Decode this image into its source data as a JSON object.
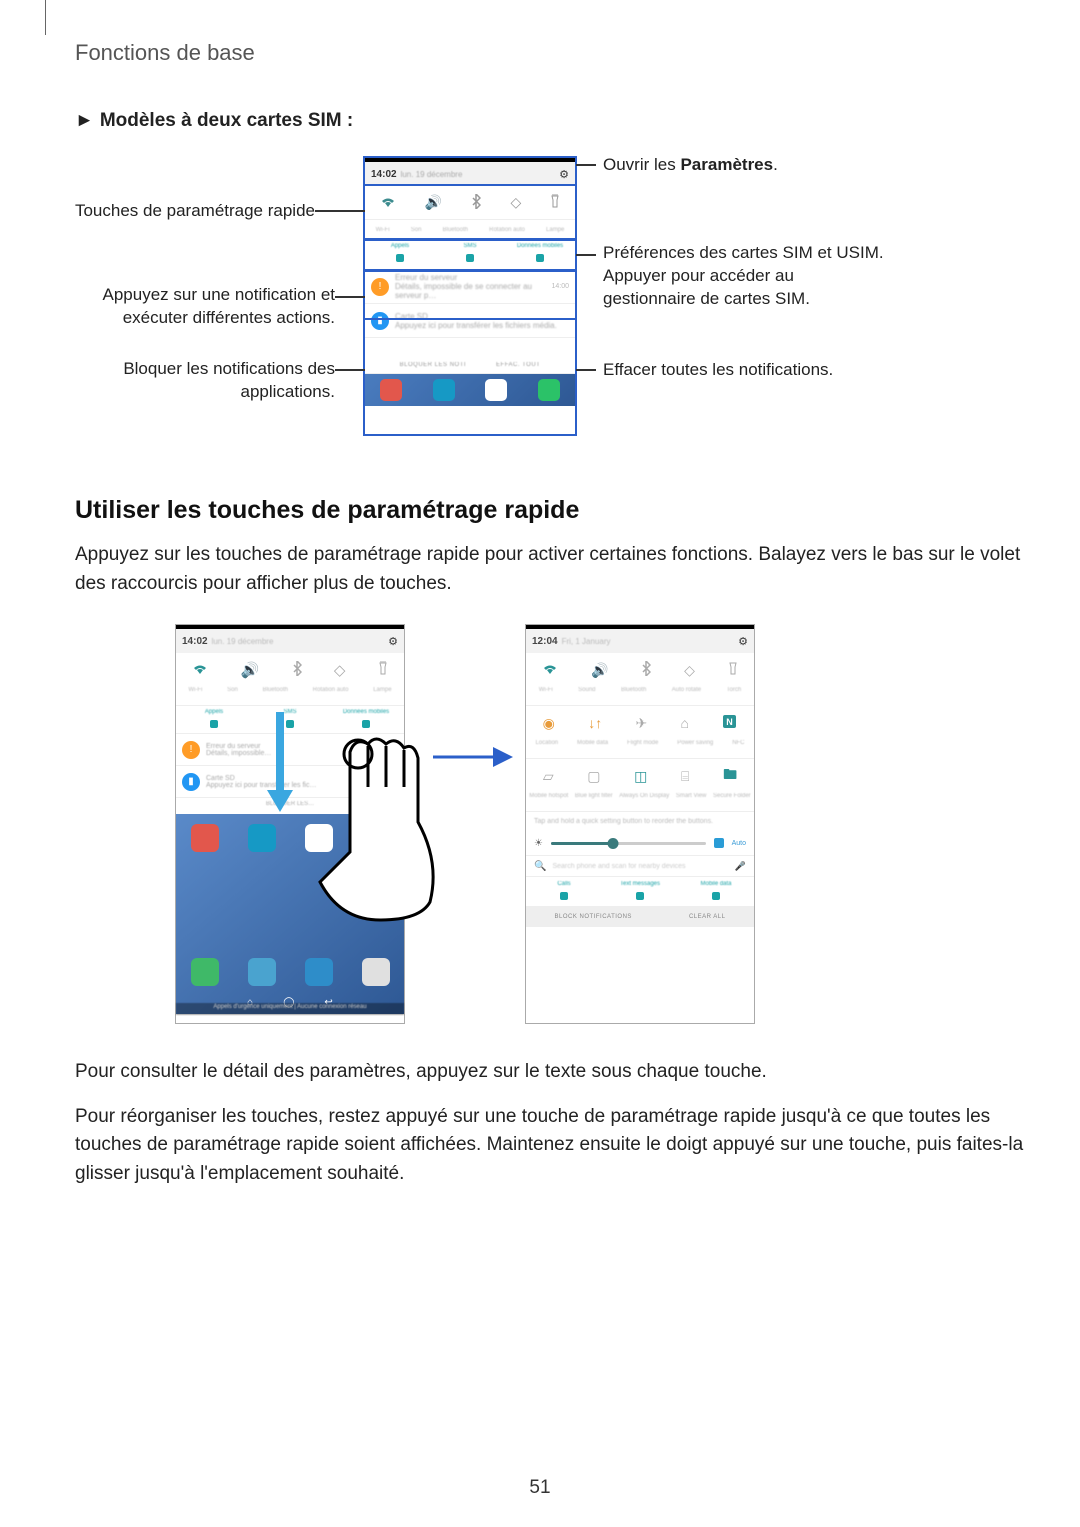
{
  "breadcrumb": "Fonctions de base",
  "subhead_arrow": "►",
  "subhead": "Modèles à deux cartes SIM",
  "subhead_colon": " :",
  "callouts": {
    "left_qs": "Touches de paramétrage rapide",
    "left_notif_l1": "Appuyez sur une notification et",
    "left_notif_l2": "exécuter différentes actions.",
    "left_block_l1": "Bloquer les notifications des",
    "left_block_l2": "applications.",
    "right_settings_pre": "Ouvrir les ",
    "right_settings_b": "Paramètres",
    "right_settings_post": ".",
    "right_sim_l1": "Préférences des cartes SIM et USIM.",
    "right_sim_l2": "Appuyer pour accéder au",
    "right_sim_l3": "gestionnaire de cartes SIM.",
    "right_clear": "Effacer toutes les notifications."
  },
  "phone1": {
    "time": "14:02",
    "date": "lun. 19 décembre",
    "qs_labels": [
      "Wi-Fi",
      "Son",
      "Bluetooth",
      "Rotation auto",
      "Lampe"
    ],
    "sim": [
      "Appels",
      "SMS",
      "Données mobiles"
    ],
    "notif1_title": "Erreur du serveur",
    "notif1_sub": "Détails, impossible de se connecter au serveur p…",
    "notif1_time": "14:00",
    "notif2_title": "Carte SD",
    "notif2_sub": "Appuyez ici pour transférer les fichiers média.",
    "clear_block": "BLOQUER LES NOTI",
    "clear_all": "EFFAC. TOUT"
  },
  "section2_heading": "Utiliser les touches de paramétrage rapide",
  "section2_p1": "Appuyez sur les touches de paramétrage rapide pour activer certaines fonctions. Balayez vers le bas sur le volet des raccourcis pour afficher plus de touches.",
  "phA": {
    "time": "14:02",
    "date": "lun. 19 décembre",
    "labels": [
      "Wi-Fi",
      "Son",
      "Bluetooth",
      "Rotation auto",
      "Lampe"
    ],
    "sim": [
      "Appels",
      "SMS",
      "Données mobiles"
    ],
    "n1": "Erreur du serveur",
    "n1s": "Détails, impossible…",
    "n2": "Carte SD",
    "n2s": "Appuyez ici pour transférer les fic…",
    "block": "BLOQUER LES…",
    "caption": "Appels d'urgence uniquement | Aucune connexion réseau"
  },
  "phB": {
    "time": "12:04",
    "date": "Fri, 1 January",
    "r1": [
      "Wi-Fi",
      "Sound",
      "Bluetooth",
      "Auto rotate",
      "Torch"
    ],
    "r2": [
      "Location",
      "Mobile data",
      "Flight mode",
      "Power saving",
      "NFC"
    ],
    "r3": [
      "Mobile hotspot",
      "Blue light filter",
      "Always On Display",
      "Smart View",
      "Secure Folder"
    ],
    "tip": "Tap and hold a quick setting button to reorder the buttons.",
    "search": "Search phone and scan for nearby devices",
    "sim": [
      "Calls",
      "Text messages",
      "Mobile data"
    ],
    "ft_block": "BLOCK NOTIFICATIONS",
    "ft_clear": "CLEAR ALL",
    "auto": "Auto"
  },
  "section2_p2": "Pour consulter le détail des paramètres, appuyez sur le texte sous chaque touche.",
  "section2_p3": "Pour réorganiser les touches, restez appuyé sur une touche de paramétrage rapide jusqu'à ce que toutes les touches de paramétrage rapide soient affichées. Maintenez ensuite le doigt appuyé sur une touche, puis faites-la glisser jusqu'à l'emplacement souhaité.",
  "page_number": "51"
}
